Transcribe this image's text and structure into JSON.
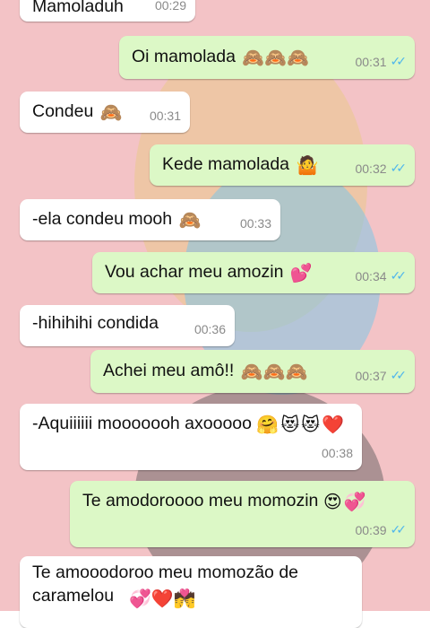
{
  "chat": {
    "messages": [
      {
        "dir": "in",
        "text": "Mamoladuh",
        "emoji": "",
        "time": "00:29"
      },
      {
        "dir": "out",
        "text": "Oi mamolada",
        "emoji": "🙈🙈🙈",
        "time": "00:31",
        "ticks": "✓✓"
      },
      {
        "dir": "in",
        "text": "Condeu",
        "emoji": "🙈",
        "time": "00:31"
      },
      {
        "dir": "out",
        "text": "Kede mamolada",
        "emoji": "🤷",
        "time": "00:32",
        "ticks": "✓✓"
      },
      {
        "dir": "in",
        "text": "-ela condeu mooh",
        "emoji": "🙈",
        "time": "00:33"
      },
      {
        "dir": "out",
        "text": "Vou achar meu amozin",
        "emoji": "💕",
        "time": "00:34",
        "ticks": "✓✓"
      },
      {
        "dir": "in",
        "text": "-hihihihi condida",
        "emoji": "",
        "time": "00:36"
      },
      {
        "dir": "out",
        "text": "Achei meu amô!!",
        "emoji": "🙈🙈🙈",
        "time": "00:37",
        "ticks": "✓✓"
      },
      {
        "dir": "in",
        "text": "-Aquiiiiii mooooooh axooooo",
        "emoji": "🤗😻😻❤️",
        "time": "00:38"
      },
      {
        "dir": "out",
        "text": "Te amodoroooo meu momozin",
        "emoji": "😍💞",
        "time": "00:39",
        "ticks": "✓✓"
      },
      {
        "dir": "in",
        "text": "Te amooodoroo meu momozão de caramelou",
        "emoji": "💞❤️💏",
        "time": ""
      }
    ]
  },
  "colors": {
    "incoming": "#ffffff",
    "outgoing": "#dcf8c6",
    "wallpaper": "#f3c3c6",
    "read_ticks": "#4fb6ec"
  }
}
